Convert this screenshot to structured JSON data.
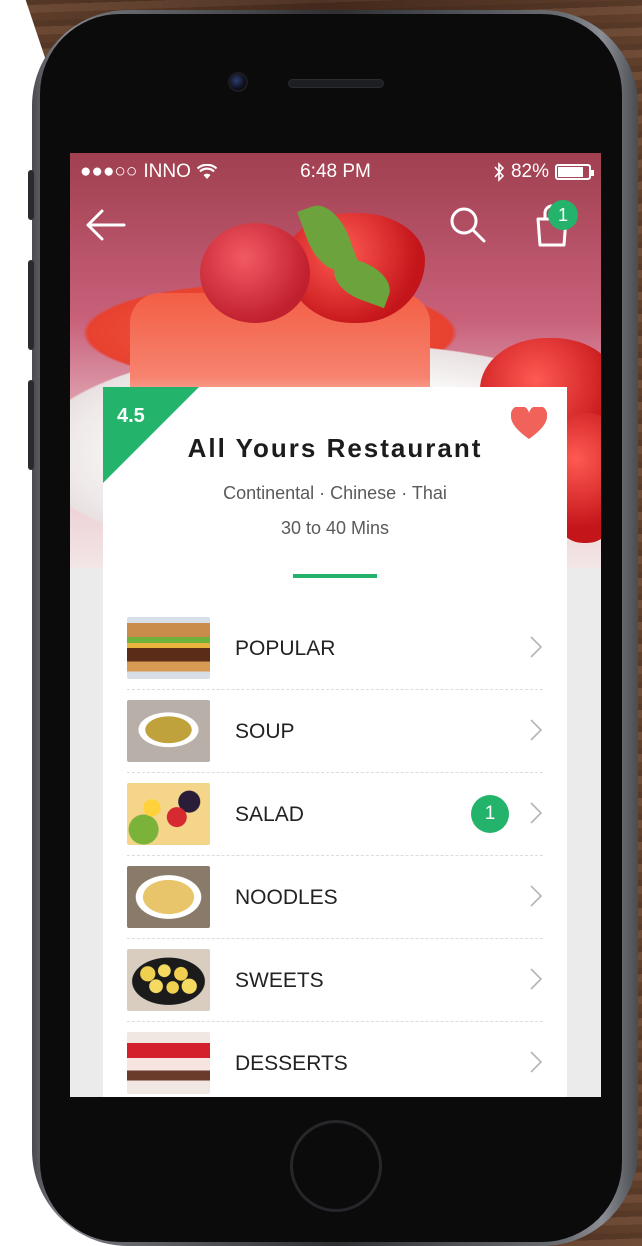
{
  "status_bar": {
    "signal": "●●●○○",
    "carrier": "INNO",
    "time": "6:48 PM",
    "battery_percent": "82%"
  },
  "nav": {
    "cart_count": "1"
  },
  "restaurant": {
    "rating": "4.5",
    "name": "All Yours Restaurant",
    "cuisines": "Continental · Chinese · Thai",
    "delivery_time": "30 to 40 Mins"
  },
  "menu": {
    "items": [
      {
        "label": "POPULAR"
      },
      {
        "label": "SOUP"
      },
      {
        "label": "SALAD",
        "badge": "1"
      },
      {
        "label": "NOODLES"
      },
      {
        "label": "SWEETS"
      },
      {
        "label": "DESSERTS"
      }
    ]
  },
  "colors": {
    "accent": "#24b36b",
    "heart": "#f0625a"
  }
}
